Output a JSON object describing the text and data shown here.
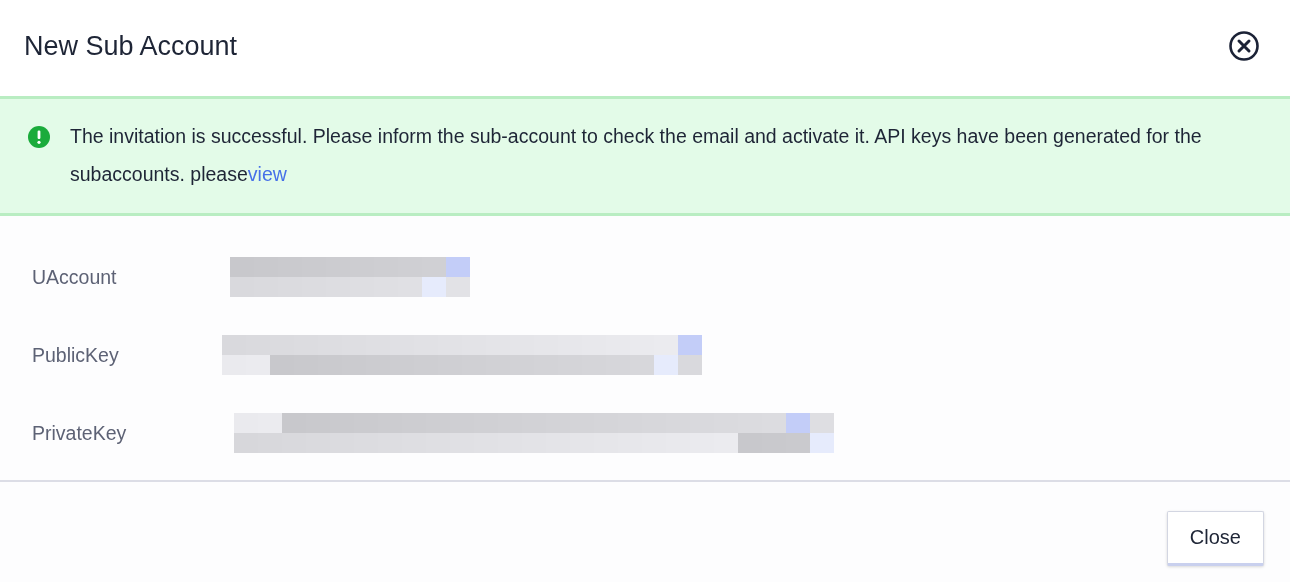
{
  "dialog": {
    "title": "New Sub Account"
  },
  "alert": {
    "kind": "success",
    "text": "The invitation is successful. Please inform the sub-account to check the email and activate it. API keys have been generated for the subaccounts. please",
    "link": "view"
  },
  "fields": [
    {
      "label": "UAccount",
      "kind": "redacted"
    },
    {
      "label": "PublicKey",
      "kind": "redacted"
    },
    {
      "label": "PrivateKey",
      "kind": "redacted"
    }
  ],
  "buttons": [
    "Close"
  ]
}
